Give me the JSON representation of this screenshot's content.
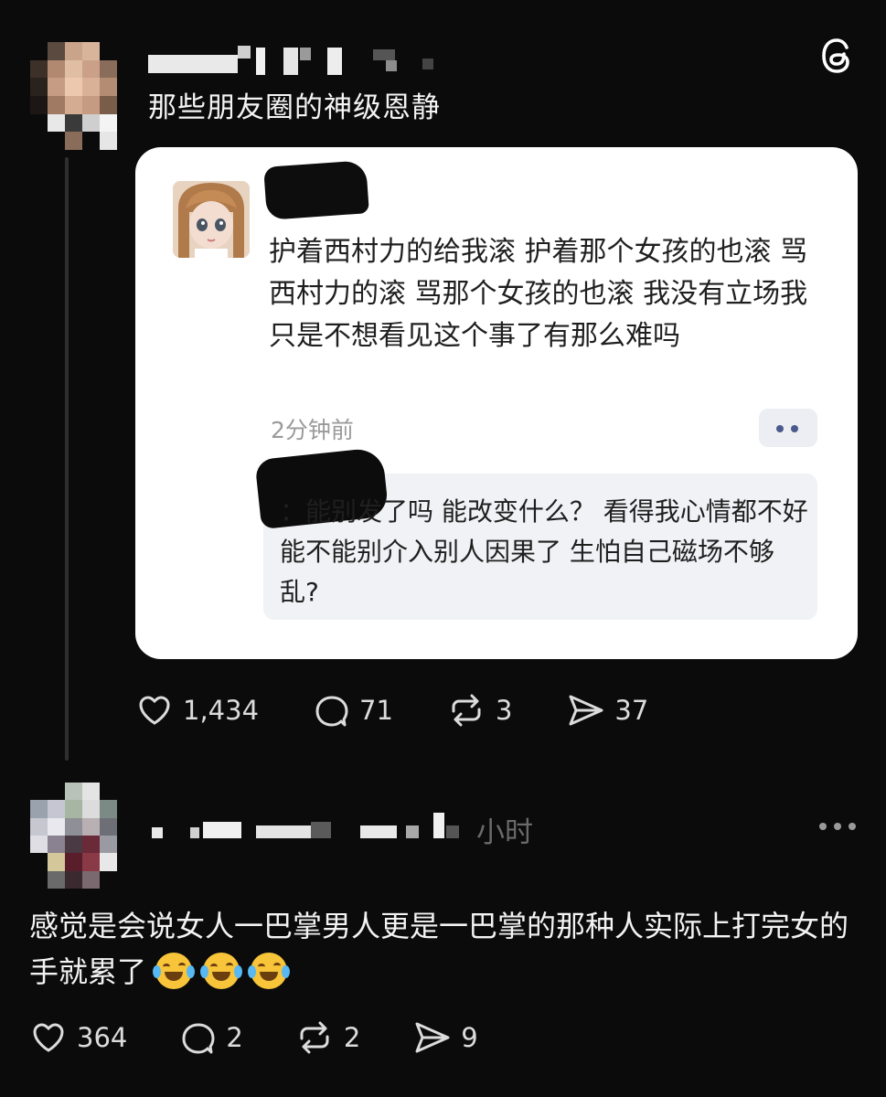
{
  "post": {
    "author_redacted": true,
    "title": "那些朋友圈的神级恩静",
    "logo_icon": "threads-logo-icon",
    "screenshot": {
      "avatar": "doll-avatar",
      "text": "护着西村力的给我滚 护着那个女孩的也滚 骂西村力的滚 骂那个女孩的也滚 我没有立场我只是不想看见这个事了有那么难吗",
      "time": "2分钟前",
      "reply_text": "：能别发了吗 能改变什么？ 看得我心情都不好 能不能别介入别人因果了 生怕自己磁场不够乱?"
    },
    "stats": {
      "likes": "1,434",
      "comments": "71",
      "reposts": "3",
      "shares": "37"
    }
  },
  "comment": {
    "time_partial": "小时",
    "text": "感觉是会说女人一巴掌男人更是一巴掌的那种人实际上打完女的手就累了",
    "emojis": [
      "laughing-crying-emoji",
      "laughing-crying-emoji",
      "laughing-crying-emoji"
    ],
    "stats": {
      "likes": "364",
      "comments": "2",
      "reposts": "2",
      "shares": "9"
    }
  },
  "colors": {
    "background": "#0b0b0b",
    "card": "#ffffff",
    "text": "#f2f2f2",
    "muted": "#9a9a9a"
  }
}
